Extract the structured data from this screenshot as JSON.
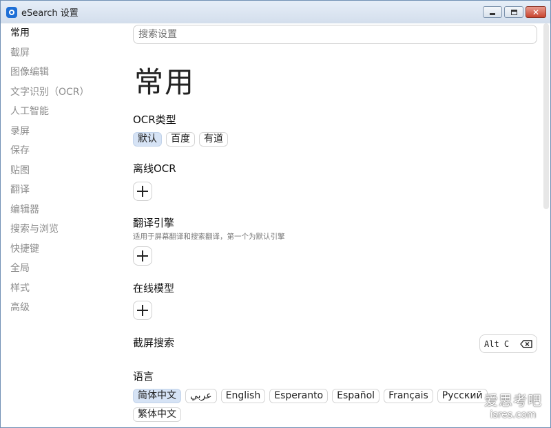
{
  "window": {
    "title": "eSearch 设置"
  },
  "sidebar": {
    "items": [
      {
        "label": "常用"
      },
      {
        "label": "截屏"
      },
      {
        "label": "图像编辑"
      },
      {
        "label": "文字识别（OCR）"
      },
      {
        "label": "人工智能"
      },
      {
        "label": "录屏"
      },
      {
        "label": "保存"
      },
      {
        "label": "贴图"
      },
      {
        "label": "翻译"
      },
      {
        "label": "编辑器"
      },
      {
        "label": "搜索与浏览"
      },
      {
        "label": "快捷键"
      },
      {
        "label": "全局"
      },
      {
        "label": "样式"
      },
      {
        "label": "高级"
      }
    ]
  },
  "search": {
    "placeholder": "搜索设置"
  },
  "page": {
    "title": "常用"
  },
  "ocr_type": {
    "title": "OCR类型",
    "options": [
      "默认",
      "百度",
      "有道"
    ]
  },
  "offline_ocr": {
    "title": "离线OCR"
  },
  "translate_engine": {
    "title": "翻译引擎",
    "hint": "适用于屏幕翻译和搜索翻译，第一个为默认引擎"
  },
  "online_model": {
    "title": "在线模型"
  },
  "screenshot_search": {
    "title": "截屏搜索",
    "hotkey": "Alt C"
  },
  "language": {
    "title": "语言",
    "options": [
      "简体中文",
      "عربي",
      "English",
      "Esperanto",
      "Español",
      "Français",
      "Русский",
      "繁体中文"
    ]
  },
  "watermark": {
    "cn": "爱思考吧",
    "en": "isres.com"
  },
  "colors": {
    "accent": "#1e6fd6",
    "selected_chip": "#d6e3f5"
  }
}
